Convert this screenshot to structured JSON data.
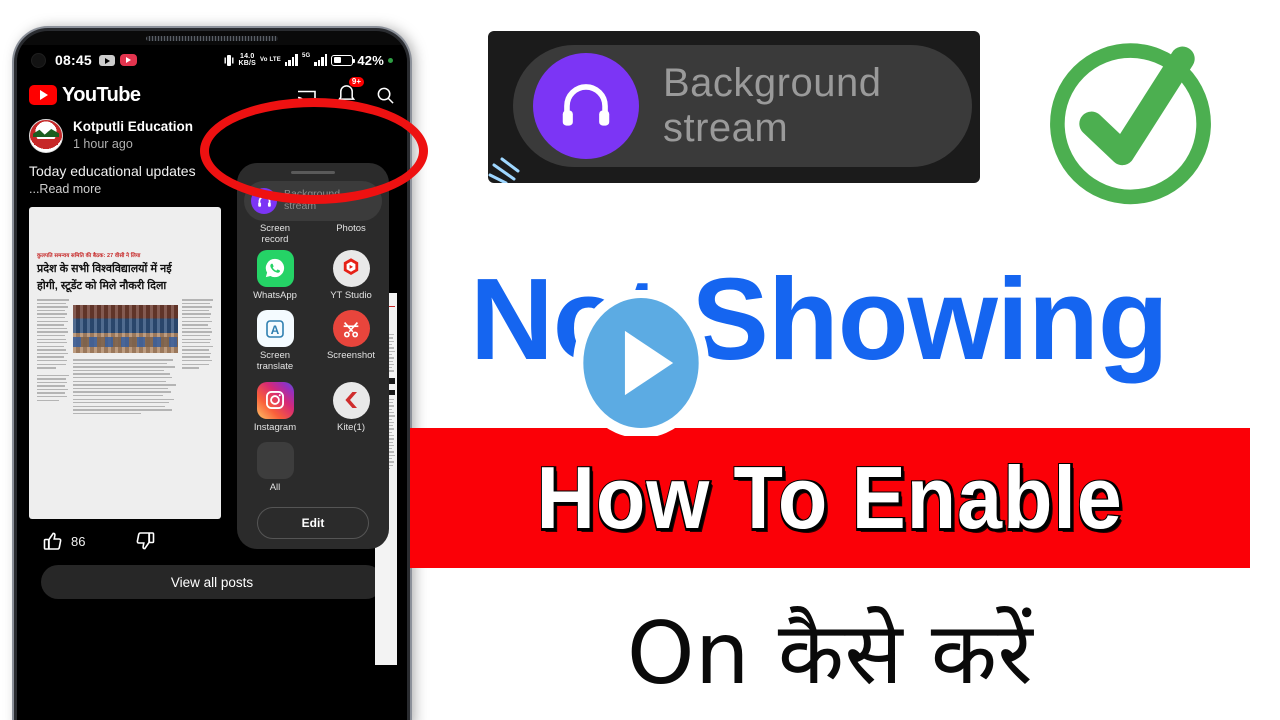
{
  "phone": {
    "status_bar": {
      "clock": "08:45",
      "net_speed_value": "14.0",
      "net_speed_unit": "KB/S",
      "volte_label": "Vo LTE",
      "network_label": "5G",
      "battery_percent": "42%"
    },
    "youtube": {
      "brand": "YouTube",
      "notification_badge": "9+",
      "icons": [
        "cast-icon",
        "notifications-icon",
        "search-icon"
      ]
    },
    "post": {
      "channel": "Kotputli Education",
      "timestamp": "1 hour ago",
      "text": "Today educational updates",
      "read_more": "...Read more",
      "like_count": "86",
      "view_all_label": "View all posts",
      "news_kicker": "कुलपति समन्वय समिति की बैठक: 27 वीसी ने लिया",
      "news_headline_1": "प्रदेश के सभी विश्वविद्यालयों में नई",
      "news_headline_2": "होगी, स्टूडेंट को मिले नौकरी दिला",
      "strip_text_1": "सीर",
      "strip_text_2": "सेंट"
    },
    "share_panel": {
      "background_stream": "Background\nstream",
      "background_stream_line1": "Background",
      "background_stream_line2": "stream",
      "top_items": [
        {
          "label_line1": "Screen",
          "label_line2": "record"
        },
        {
          "label_line1": "Photos",
          "label_line2": ""
        }
      ],
      "apps": [
        {
          "label": "WhatsApp",
          "icon": "whatsapp-icon"
        },
        {
          "label": "YT Studio",
          "icon": "yt-studio-icon"
        },
        {
          "label": "Screen translate",
          "label_line1": "Screen",
          "label_line2": "translate",
          "icon": "screen-translate-icon"
        },
        {
          "label": "Screenshot",
          "icon": "screenshot-icon"
        },
        {
          "label": "Instagram",
          "icon": "instagram-icon"
        },
        {
          "label": "Kite(1)",
          "icon": "kite-icon"
        },
        {
          "label": "All",
          "icon": "all-apps-folder-icon"
        }
      ],
      "edit_label": "Edit"
    }
  },
  "callout": {
    "title_line1": "Background",
    "title_line2": "stream",
    "icon": "headphones-icon"
  },
  "headline": {
    "not_showing": "Not Showing",
    "how_to_enable": "How To Enable",
    "bottom_hindi": "On कैसे करें"
  },
  "colors": {
    "blue_text": "#1565f0",
    "red_banner": "#fb0007",
    "red_annotation": "#ee1111",
    "green_check": "#4caf50",
    "purple_icon": "#7c35f5",
    "play_badge": "#5cabe3"
  }
}
